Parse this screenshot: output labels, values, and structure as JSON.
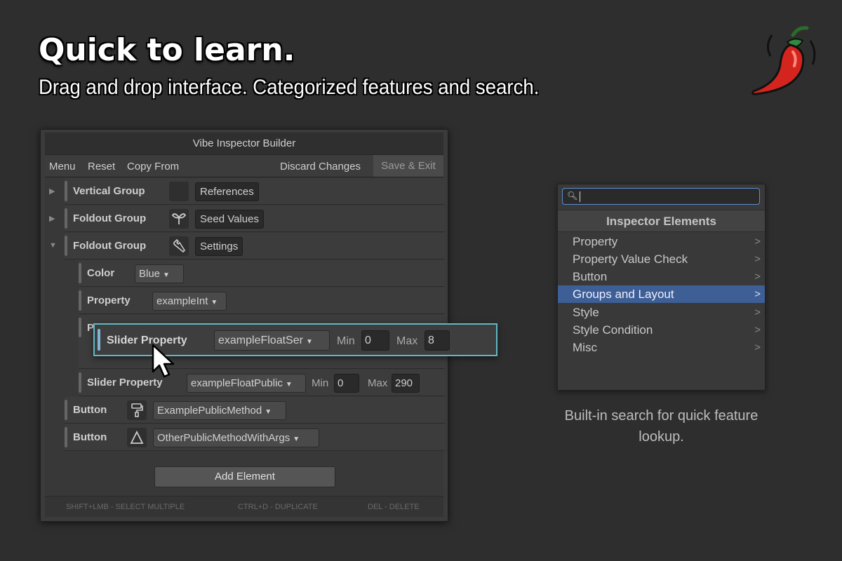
{
  "hero": {
    "title": "Quick to learn.",
    "subtitle": "Drag and drop interface. Categorized features and search."
  },
  "builder": {
    "title": "Vibe Inspector Builder",
    "toolbar": {
      "menu": "Menu",
      "reset": "Reset",
      "copy_from": "Copy From",
      "discard": "Discard Changes",
      "save_exit": "Save & Exit"
    },
    "rows": [
      {
        "label": "Vertical Group",
        "icon": "empty-icon",
        "button": "References",
        "expanded": false
      },
      {
        "label": "Foldout Group",
        "icon": "sprout-icon",
        "button": "Seed Values",
        "expanded": false
      },
      {
        "label": "Foldout Group",
        "icon": "wrench-icon",
        "button": "Settings",
        "expanded": true
      }
    ],
    "children": {
      "color_label": "Color",
      "color_value": "Blue",
      "property_label": "Property",
      "property_value": "exampleInt",
      "hidden_label": "P",
      "slider_label": "Slider Property",
      "slider_value": "exampleFloatPublic",
      "slider_min_label": "Min",
      "slider_min": "0",
      "slider_max_label": "Max",
      "slider_max": "290"
    },
    "buttons": [
      {
        "label": "Button",
        "icon": "paint-roller-icon",
        "method": "ExamplePublicMethod"
      },
      {
        "label": "Button",
        "icon": "triangle-icon",
        "method": "OtherPublicMethodWithArgs"
      }
    ],
    "add_element": "Add Element",
    "shortcuts": {
      "select": "SHIFT+LMB - SELECT MULTIPLE",
      "duplicate": "CTRL+D - DUPLICATE",
      "delete": "DEL - DELETE"
    }
  },
  "drag": {
    "label": "Slider Property",
    "value": "exampleFloatSer",
    "min_label": "Min",
    "min": "0",
    "max_label": "Max",
    "max": "8"
  },
  "search": {
    "query": "",
    "header": "Inspector Elements",
    "items": [
      "Property",
      "Property Value Check",
      "Button",
      "Groups and Layout",
      "Style",
      "Style Condition",
      "Misc"
    ],
    "selected": "Groups and Layout",
    "caption": "Built-in search for quick feature lookup."
  },
  "colors": {
    "background": "#2e2e2e",
    "accent_selection": "#3d5f96",
    "drag_outline": "#5fb8c4",
    "search_outline": "#5b8fd4"
  }
}
